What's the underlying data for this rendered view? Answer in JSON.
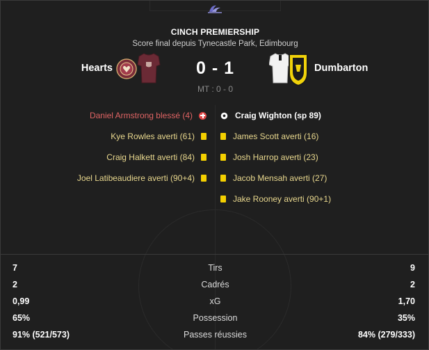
{
  "header": {
    "competition": "CINCH PREMIERSHIP",
    "subtitle": "Score final depuis Tynecastle Park, Edimbourg",
    "home_team": "Hearts",
    "away_team": "Dumbarton",
    "score": "0 - 1",
    "halftime": "MT : 0 - 0"
  },
  "events": {
    "home": [
      {
        "text": "Daniel Armstrong blessé (4)",
        "type": "injury",
        "icon": "injury-icon"
      },
      {
        "text": "Kye Rowles averti (61)",
        "type": "yellow",
        "icon": "yellow-card-icon"
      },
      {
        "text": "Craig Halkett averti (84)",
        "type": "yellow",
        "icon": "yellow-card-icon"
      },
      {
        "text": "Joel Latibeaudiere averti (90+4)",
        "type": "yellow",
        "icon": "yellow-card-icon"
      }
    ],
    "away": [
      {
        "text": "Craig Wighton (sp 89)",
        "type": "goal",
        "icon": "ball-icon"
      },
      {
        "text": "James Scott averti (16)",
        "type": "yellow",
        "icon": "yellow-card-icon"
      },
      {
        "text": "Josh Harrop averti (23)",
        "type": "yellow",
        "icon": "yellow-card-icon"
      },
      {
        "text": "Jacob Mensah averti (27)",
        "type": "yellow",
        "icon": "yellow-card-icon"
      },
      {
        "text": "Jake Rooney averti (90+1)",
        "type": "yellow",
        "icon": "yellow-card-icon"
      }
    ]
  },
  "stats": [
    {
      "label": "Tirs",
      "home": "7",
      "away": "9"
    },
    {
      "label": "Cadrés",
      "home": "2",
      "away": "2"
    },
    {
      "label": "xG",
      "home": "0,99",
      "away": "1,70"
    },
    {
      "label": "Possession",
      "home": "65%",
      "away": "35%"
    },
    {
      "label": "Passes réussies",
      "home": "91% (521/573)",
      "away": "84% (279/333)"
    }
  ],
  "colors": {
    "background": "#1f1f1f",
    "card_text": "#e9d88e",
    "injury_text": "#e06464",
    "yellow_card": "#f4d000",
    "home_kit": "#6b2a35",
    "away_kit": "#f0d20a"
  }
}
